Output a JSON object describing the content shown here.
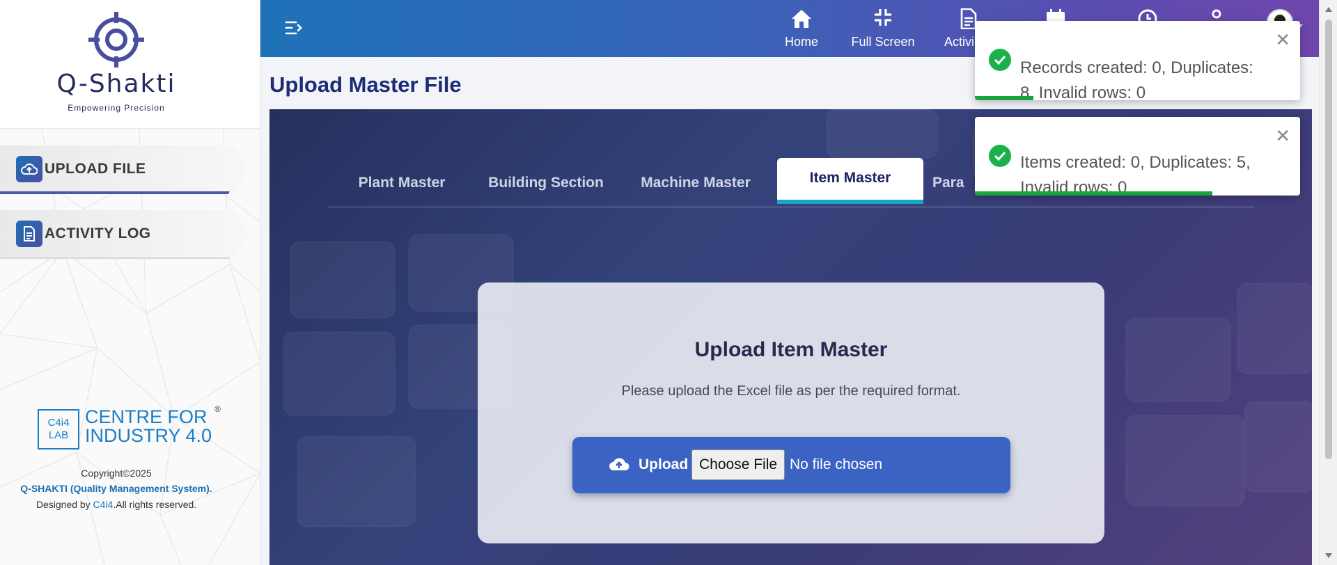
{
  "app": {
    "logo_text": "Q-Shakti",
    "logo_tagline": "Empowering Precision"
  },
  "sidebar": {
    "items": [
      {
        "label": "UPLOAD FILE",
        "icon": "cloud-upload-icon",
        "active": true
      },
      {
        "label": "ACTIVITY LOG",
        "icon": "document-icon",
        "active": false
      }
    ],
    "footer": {
      "partner_box": "C4i4\nLAB",
      "partner_box_line1": "C4i4",
      "partner_box_line2": "LAB",
      "partner_name_line1": "CENTRE FOR",
      "partner_name_line2": "INDUSTRY 4.0",
      "registered_mark": "®",
      "copyright": "Copyright©2025",
      "system_name": "Q-SHAKTI (Quality Management System).",
      "designed_by_prefix": "Designed by ",
      "designed_by_link": "C4i4",
      "designed_by_suffix": ".All rights reserved."
    }
  },
  "topbar": {
    "items": [
      {
        "label": "Home",
        "icon": "home-icon"
      },
      {
        "label": "Full Screen",
        "icon": "fullscreen-exit-icon"
      },
      {
        "label": "Activi",
        "icon": "document-icon"
      }
    ],
    "hidden_icons": [
      "calendar-icon",
      "clock-icon",
      "user-icon",
      "avatar-icon"
    ]
  },
  "page": {
    "title": "Upload Master File"
  },
  "tabs": [
    {
      "label": "Plant Master",
      "active": false
    },
    {
      "label": "Building Section",
      "active": false
    },
    {
      "label": "Machine Master",
      "active": false
    },
    {
      "label": "Item Master",
      "active": true
    },
    {
      "label": "Para",
      "active": false
    }
  ],
  "upload_card": {
    "title": "Upload Item Master",
    "subtitle": "Please upload the Excel file as per the required format.",
    "button_label": "Upload",
    "choose_file_label": "Choose File",
    "no_file_text": "No file chosen"
  },
  "toasts": [
    {
      "message": "Records created: 0, Duplicates: 8, Invalid rows: 0",
      "progress": 0.18
    },
    {
      "message": "Items created: 0, Duplicates: 5, Invalid rows: 0",
      "progress": 0.73
    }
  ],
  "colors": {
    "accent": "#3b63c3",
    "title": "#1c2a78",
    "tab_indicator": "#14a7c6",
    "success": "#1bb14a"
  }
}
